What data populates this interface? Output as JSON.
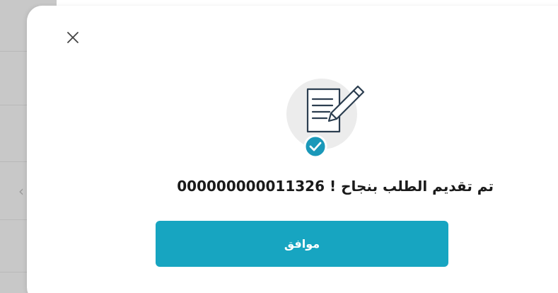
{
  "dialog": {
    "success_message": "تم تقديم الطلب بنجاح ! 000000000011326",
    "ok_button_label": "موافق",
    "icons": {
      "close": "close-icon",
      "illustration": "document-edit-icon",
      "badge": "checkmark-badge-icon",
      "side_arrow": "chevron-left-icon"
    },
    "colors": {
      "primary": "#17a5c1",
      "badge": "#1a98b9",
      "illustration_stroke": "#2c3e50",
      "illustration_bg": "#ececec"
    }
  }
}
